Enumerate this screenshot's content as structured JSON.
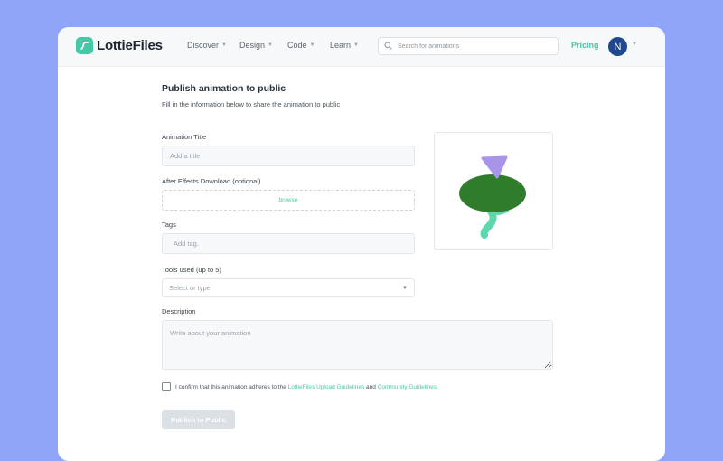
{
  "brand": {
    "name": "LottieFiles",
    "logo_color": "#45c8a5"
  },
  "nav": {
    "items": [
      {
        "label": "Discover"
      },
      {
        "label": "Design"
      },
      {
        "label": "Code"
      },
      {
        "label": "Learn"
      }
    ],
    "search_placeholder": "Search for animations",
    "pricing": "Pricing",
    "avatar_initial": "N"
  },
  "form": {
    "title": "Publish animation to public",
    "subtitle": "Fill in the information below to share the animation to public",
    "animation_title": {
      "label": "Animation Title",
      "placeholder": "Add a title",
      "value": ""
    },
    "ae_download": {
      "label": "After Effects Download  (optional)",
      "browse": "browse"
    },
    "tags": {
      "label": "Tags",
      "placeholder": "Add tag."
    },
    "tools": {
      "label": "Tools used (up to 5)",
      "placeholder": "Select or type"
    },
    "description": {
      "label": "Description",
      "placeholder": "Write about your animation"
    },
    "confirm": {
      "prefix": "I confirm that this animation adheres to the",
      "link1": "LottieFiles Upload Guidelines",
      "and": "and",
      "link2": "Community Guidelines",
      "suffix": ".",
      "checked": false
    },
    "publish": "Publish to Public"
  },
  "colors": {
    "page_bg": "#8ea5f8",
    "accent": "#45c8a5",
    "avatar": "#1f4b8e",
    "blob": "#2f7d2a",
    "triangle": "#a894e8",
    "squiggle": "#5fd6ad"
  }
}
